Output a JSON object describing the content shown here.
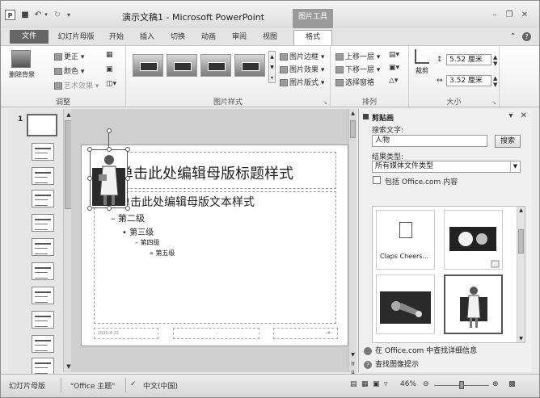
{
  "window": {
    "title": "演示文稿1 - Microsoft PowerPoint",
    "context_tool": "图片工具",
    "app_badge": "P"
  },
  "tabs": [
    {
      "label": "文件"
    },
    {
      "label": "幻灯片母版"
    },
    {
      "label": "开始"
    },
    {
      "label": "插入"
    },
    {
      "label": "切换"
    },
    {
      "label": "动画"
    },
    {
      "label": "审阅"
    },
    {
      "label": "视图"
    },
    {
      "label": "格式"
    }
  ],
  "ribbon": {
    "adjust": {
      "label": "调整",
      "remove_bg": "删除背景",
      "corrections": "更正",
      "color": "颜色",
      "artistic": "艺术效果"
    },
    "styles": {
      "label": "图片样式",
      "border": "图片边框",
      "effects": "图片效果",
      "layout": "图片版式"
    },
    "arrange": {
      "label": "排列",
      "forward": "上移一层",
      "backward": "下移一层",
      "pane": "选择窗格"
    },
    "size": {
      "label": "大小",
      "crop": "裁剪",
      "height": "5.52 厘米",
      "width": "3.52 厘米"
    }
  },
  "slide": {
    "title": "单击此处编辑母版标题样式",
    "level1": "单击此处编辑母版文本样式",
    "level2": "– 第二级",
    "level3": "• 第三级",
    "level4": "– 第四级",
    "level5": "» 第五级",
    "date": "2020-4-22"
  },
  "clipart": {
    "title": "剪贴画",
    "search_label": "搜索文字:",
    "search_value": "人物",
    "search_button": "搜索",
    "type_label": "结果类型:",
    "type_value": "所有媒体文件类型",
    "include_label": "包括 Office.com 内容",
    "item1_caption": "Claps Cheers...",
    "footer_link1": "在 Office.com 中查找详细信息",
    "footer_link2": "查找图像提示"
  },
  "status": {
    "view": "幻灯片母版",
    "theme": "\"Office 主题\"",
    "language": "中文(中国)",
    "zoom": "46%"
  }
}
